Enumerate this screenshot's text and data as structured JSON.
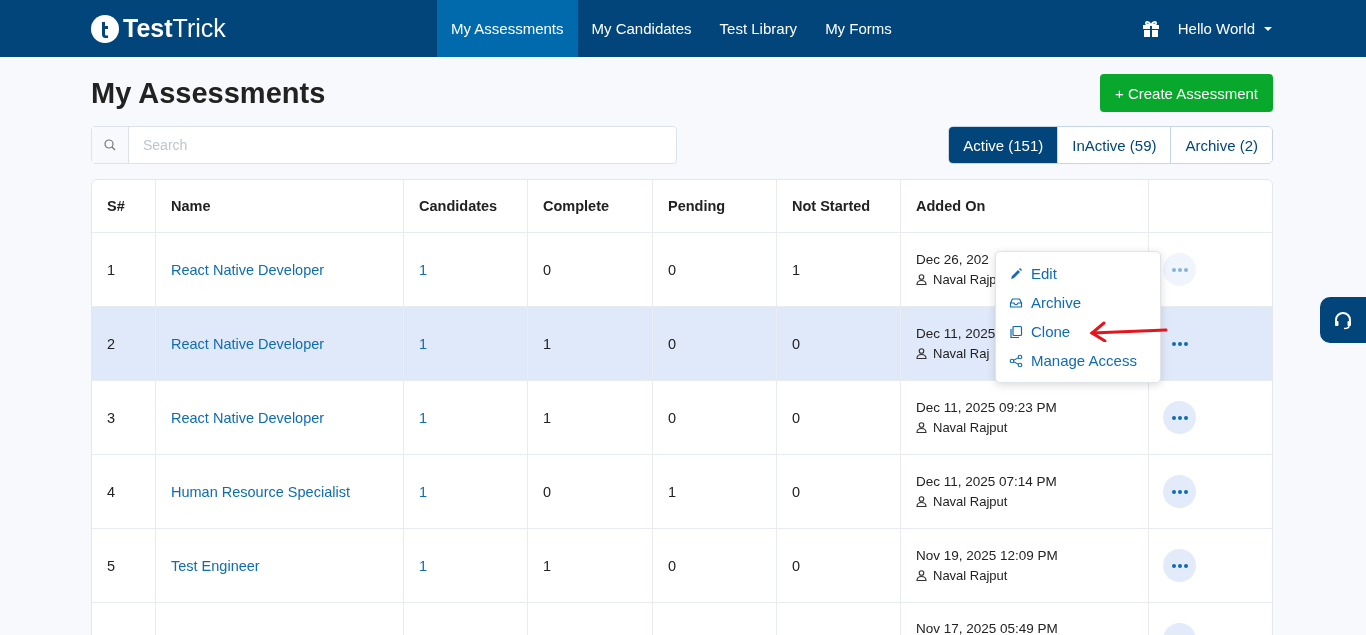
{
  "brand": {
    "name_bold": "Test",
    "name_light": "Trick"
  },
  "nav": [
    {
      "label": "My Assessments",
      "selected": true
    },
    {
      "label": "My Candidates",
      "selected": false
    },
    {
      "label": "Test Library",
      "selected": false
    },
    {
      "label": "My Forms",
      "selected": false
    }
  ],
  "user": {
    "name": "Hello World"
  },
  "page_title": "My Assessments",
  "create_button": "+ Create Assessment",
  "search": {
    "placeholder": "Search"
  },
  "filters": [
    {
      "label": "Active (151)",
      "selected": true
    },
    {
      "label": "InActive (59)",
      "selected": false
    },
    {
      "label": "Archive (2)",
      "selected": false
    }
  ],
  "table": {
    "columns": [
      "S#",
      "Name",
      "Candidates",
      "Complete",
      "Pending",
      "Not Started",
      "Added On"
    ],
    "rows": [
      {
        "sn": "1",
        "name": "React Native Developer",
        "candidates": "1",
        "complete": "0",
        "pending": "0",
        "not_started": "1",
        "added_on": "Dec 26, 202",
        "added_by": "Naval Rajp",
        "selected": false
      },
      {
        "sn": "2",
        "name": "React Native Developer",
        "candidates": "1",
        "complete": "1",
        "pending": "0",
        "not_started": "0",
        "added_on": "Dec 11, 2025",
        "added_by": "Naval Raj",
        "selected": true
      },
      {
        "sn": "3",
        "name": "React Native Developer",
        "candidates": "1",
        "complete": "1",
        "pending": "0",
        "not_started": "0",
        "added_on": "Dec 11, 2025 09:23 PM",
        "added_by": "Naval Rajput",
        "selected": false
      },
      {
        "sn": "4",
        "name": "Human Resource Specialist",
        "candidates": "1",
        "complete": "0",
        "pending": "1",
        "not_started": "0",
        "added_on": "Dec 11, 2025 07:14 PM",
        "added_by": "Naval Rajput",
        "selected": false
      },
      {
        "sn": "5",
        "name": "Test Engineer",
        "candidates": "1",
        "complete": "1",
        "pending": "0",
        "not_started": "0",
        "added_on": "Nov 19, 2025 12:09 PM",
        "added_by": "Naval Rajput",
        "selected": false
      },
      {
        "added_on": "Nov 17, 2025 05:49 PM",
        "selected": false
      }
    ]
  },
  "row_menu": [
    {
      "kind": "edit",
      "label": "Edit"
    },
    {
      "kind": "archive",
      "label": "Archive"
    },
    {
      "kind": "clone",
      "label": "Clone"
    },
    {
      "kind": "share",
      "label": "Manage Access"
    }
  ]
}
